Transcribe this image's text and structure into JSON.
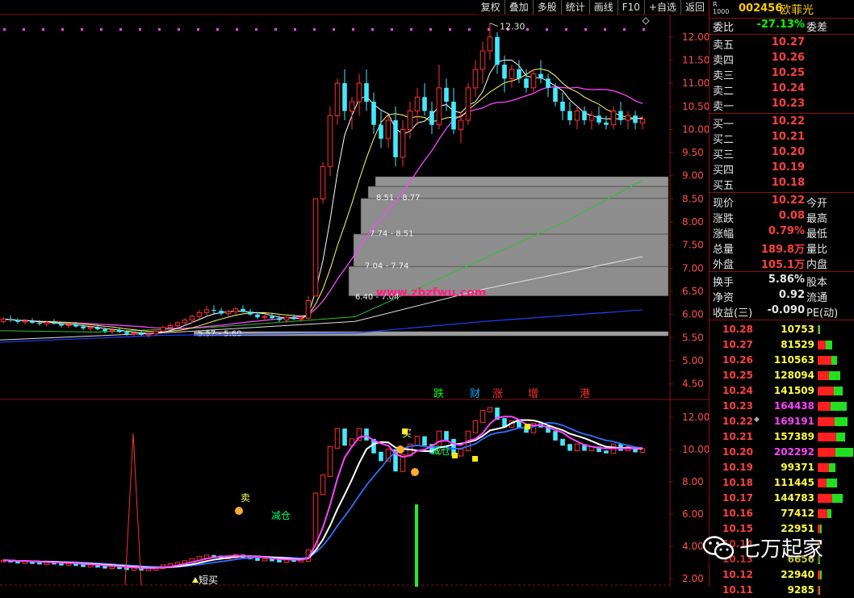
{
  "toolbar": [
    "复权",
    "叠加",
    "多股",
    "统计",
    "画线",
    "F10",
    "+自选",
    "返回"
  ],
  "stock": {
    "badge_top": "R",
    "badge_bottom": "1000",
    "code": "002456",
    "name": "欧菲光"
  },
  "quote": {
    "weibi": {
      "label": "委比",
      "value": "-27.13%",
      "label2": "委差"
    },
    "sell": [
      {
        "label": "卖五",
        "price": "10.27"
      },
      {
        "label": "卖四",
        "price": "10.26"
      },
      {
        "label": "卖三",
        "price": "10.25"
      },
      {
        "label": "卖二",
        "price": "10.24"
      },
      {
        "label": "卖一",
        "price": "10.23"
      }
    ],
    "buy": [
      {
        "label": "买一",
        "price": "10.22"
      },
      {
        "label": "买二",
        "price": "10.21"
      },
      {
        "label": "买三",
        "price": "10.20"
      },
      {
        "label": "买四",
        "price": "10.19"
      },
      {
        "label": "买五",
        "price": "10.18"
      }
    ],
    "stats": [
      {
        "label": "现价",
        "value": "10.22",
        "label2": "今开"
      },
      {
        "label": "涨跌",
        "value": "0.08",
        "label2": "最高"
      },
      {
        "label": "涨幅",
        "value": "0.79%",
        "label2": "最低"
      },
      {
        "label": "总量",
        "value": "189.8万",
        "label2": "量比"
      },
      {
        "label": "外盘",
        "value": "105.1万",
        "label2": "内盘"
      }
    ],
    "stats2": [
      {
        "label": "换手",
        "value": "5.86%",
        "label2": "股本"
      },
      {
        "label": "净资",
        "value": "0.92",
        "label2": "流通"
      },
      {
        "label": "收益(三)",
        "value": "-0.090",
        "label2": "PE(动)"
      }
    ]
  },
  "trades": [
    {
      "price": "10.28",
      "vol": "10753"
    },
    {
      "price": "10.27",
      "vol": "81529"
    },
    {
      "price": "10.26",
      "vol": "110563"
    },
    {
      "price": "10.25",
      "vol": "128094"
    },
    {
      "price": "10.24",
      "vol": "141509"
    },
    {
      "price": "10.23",
      "vol": "164438"
    },
    {
      "price": "10.22",
      "vol": "169191"
    },
    {
      "price": "10.21",
      "vol": "157389"
    },
    {
      "price": "10.20",
      "vol": "202292"
    },
    {
      "price": "10.19",
      "vol": "99371"
    },
    {
      "price": "10.18",
      "vol": "111445"
    },
    {
      "price": "10.17",
      "vol": "144783"
    },
    {
      "price": "10.16",
      "vol": "77412"
    },
    {
      "price": "10.15",
      "vol": "22951"
    },
    {
      "price": "10.14",
      "vol": ""
    },
    {
      "price": "10.13",
      "vol": "6656"
    },
    {
      "price": "10.12",
      "vol": "22940"
    },
    {
      "price": "10.11",
      "vol": "9285"
    }
  ],
  "watermark": {
    "text": "七万起家",
    "site": "www.zbzfwu.com"
  },
  "chart_data": {
    "type": "candlestick",
    "upper_axis": [
      "12.00",
      "11.50",
      "11.00",
      "10.50",
      "10.00",
      "9.50",
      "9.00",
      "8.50",
      "8.00",
      "7.50",
      "7.00",
      "6.50",
      "6.00",
      "5.50",
      "5.00",
      "4.50"
    ],
    "upper_ylim": [
      4.25,
      12.45
    ],
    "lower_axis": [
      "12.00",
      "10.00",
      "8.00",
      "6.00",
      "4.00",
      "2.00"
    ],
    "lower_ylim": [
      1.5,
      13.0
    ],
    "high_label": "12.30",
    "chip_zones": [
      "5.57 - 5.60",
      "6.40 - 7.04",
      "7.04 - 7.74",
      "7.74 - 8.51",
      "8.51 - 8.77"
    ],
    "events": [
      "跌",
      "财",
      "涨",
      "增",
      "港"
    ],
    "signals": [
      "卖",
      "减仓",
      "买",
      "减仓",
      "短买"
    ],
    "ohlc": [
      [
        5.85,
        5.95,
        5.8,
        5.9
      ],
      [
        5.9,
        5.98,
        5.84,
        5.88
      ],
      [
        5.88,
        5.92,
        5.8,
        5.84
      ],
      [
        5.84,
        5.9,
        5.78,
        5.86
      ],
      [
        5.86,
        5.92,
        5.8,
        5.82
      ],
      [
        5.82,
        5.88,
        5.76,
        5.8
      ],
      [
        5.8,
        5.86,
        5.74,
        5.83
      ],
      [
        5.83,
        5.9,
        5.78,
        5.8
      ],
      [
        5.8,
        5.84,
        5.72,
        5.76
      ],
      [
        5.76,
        5.82,
        5.7,
        5.78
      ],
      [
        5.78,
        5.84,
        5.72,
        5.74
      ],
      [
        5.74,
        5.78,
        5.66,
        5.7
      ],
      [
        5.7,
        5.76,
        5.64,
        5.72
      ],
      [
        5.72,
        5.78,
        5.66,
        5.68
      ],
      [
        5.68,
        5.72,
        5.6,
        5.64
      ],
      [
        5.64,
        5.7,
        5.58,
        5.66
      ],
      [
        5.66,
        5.72,
        5.6,
        5.62
      ],
      [
        5.62,
        5.66,
        5.54,
        5.58
      ],
      [
        5.58,
        5.64,
        5.52,
        5.6
      ],
      [
        5.6,
        5.66,
        5.54,
        5.56
      ],
      [
        5.56,
        5.62,
        5.5,
        5.58
      ],
      [
        5.58,
        5.68,
        5.54,
        5.64
      ],
      [
        5.64,
        5.76,
        5.6,
        5.72
      ],
      [
        5.72,
        5.8,
        5.66,
        5.76
      ],
      [
        5.76,
        5.86,
        5.7,
        5.82
      ],
      [
        5.82,
        5.92,
        5.76,
        5.88
      ],
      [
        5.88,
        6.0,
        5.82,
        5.96
      ],
      [
        5.96,
        6.1,
        5.9,
        6.04
      ],
      [
        6.04,
        6.18,
        5.98,
        6.1
      ],
      [
        6.1,
        6.2,
        6.02,
        6.08
      ],
      [
        6.08,
        6.14,
        5.98,
        6.02
      ],
      [
        6.02,
        6.1,
        5.96,
        6.06
      ],
      [
        6.06,
        6.16,
        6.0,
        6.12
      ],
      [
        6.12,
        6.2,
        6.04,
        6.06
      ],
      [
        6.06,
        6.12,
        5.98,
        6.0
      ],
      [
        6.0,
        6.06,
        5.9,
        5.94
      ],
      [
        5.94,
        6.0,
        5.86,
        5.96
      ],
      [
        5.96,
        6.04,
        5.9,
        5.92
      ],
      [
        5.92,
        5.98,
        5.84,
        5.88
      ],
      [
        5.88,
        5.96,
        5.82,
        5.94
      ],
      [
        5.94,
        6.0,
        5.88,
        5.9
      ],
      [
        5.9,
        5.96,
        5.84,
        5.92
      ],
      [
        5.92,
        6.4,
        5.9,
        6.3
      ],
      [
        6.4,
        8.5,
        6.4,
        8.5
      ],
      [
        8.5,
        9.3,
        8.4,
        9.2
      ],
      [
        9.2,
        10.5,
        9.0,
        10.3
      ],
      [
        10.3,
        11.1,
        10.1,
        11.0
      ],
      [
        11.0,
        11.3,
        10.2,
        10.4
      ],
      [
        10.4,
        10.7,
        10.0,
        10.6
      ],
      [
        10.6,
        11.2,
        10.3,
        11.0
      ],
      [
        11.0,
        11.3,
        10.4,
        10.6
      ],
      [
        10.6,
        10.8,
        9.9,
        10.1
      ],
      [
        10.1,
        10.4,
        9.6,
        9.8
      ],
      [
        9.8,
        10.3,
        9.6,
        10.2
      ],
      [
        10.2,
        10.5,
        9.2,
        9.4
      ],
      [
        9.4,
        10.2,
        9.2,
        10.0
      ],
      [
        10.0,
        10.6,
        9.8,
        10.4
      ],
      [
        10.4,
        10.9,
        10.1,
        10.7
      ],
      [
        10.7,
        11.0,
        10.3,
        10.4
      ],
      [
        10.4,
        10.6,
        9.9,
        10.1
      ],
      [
        10.1,
        11.4,
        10.0,
        10.9
      ],
      [
        10.9,
        11.1,
        10.4,
        10.6
      ],
      [
        10.6,
        10.9,
        9.9,
        10.0
      ],
      [
        10.0,
        10.4,
        9.7,
        10.2
      ],
      [
        10.2,
        11.0,
        10.1,
        10.9
      ],
      [
        10.9,
        11.5,
        10.7,
        11.3
      ],
      [
        11.3,
        11.9,
        11.0,
        11.7
      ],
      [
        11.7,
        12.3,
        11.5,
        12.0
      ],
      [
        12.0,
        12.1,
        11.2,
        11.4
      ],
      [
        11.4,
        11.6,
        10.8,
        11.1
      ],
      [
        11.1,
        11.4,
        10.9,
        11.3
      ],
      [
        11.3,
        11.5,
        11.0,
        11.1
      ],
      [
        11.1,
        11.3,
        10.8,
        10.9
      ],
      [
        10.9,
        11.3,
        10.8,
        11.2
      ],
      [
        11.2,
        11.5,
        11.0,
        11.1
      ],
      [
        11.1,
        11.2,
        10.7,
        10.9
      ],
      [
        10.9,
        11.0,
        10.5,
        10.6
      ],
      [
        10.6,
        10.8,
        10.2,
        10.4
      ],
      [
        10.4,
        10.6,
        10.1,
        10.2
      ],
      [
        10.2,
        10.5,
        10.0,
        10.4
      ],
      [
        10.4,
        10.5,
        10.1,
        10.2
      ],
      [
        10.2,
        10.4,
        10.0,
        10.3
      ],
      [
        10.3,
        10.5,
        10.1,
        10.15
      ],
      [
        10.15,
        10.3,
        10.0,
        10.1
      ],
      [
        10.1,
        10.5,
        10.0,
        10.4
      ],
      [
        10.4,
        10.6,
        10.1,
        10.2
      ],
      [
        10.2,
        10.4,
        10.0,
        10.3
      ],
      [
        10.3,
        10.4,
        10.0,
        10.14
      ],
      [
        10.14,
        10.3,
        10.0,
        10.22
      ]
    ]
  }
}
